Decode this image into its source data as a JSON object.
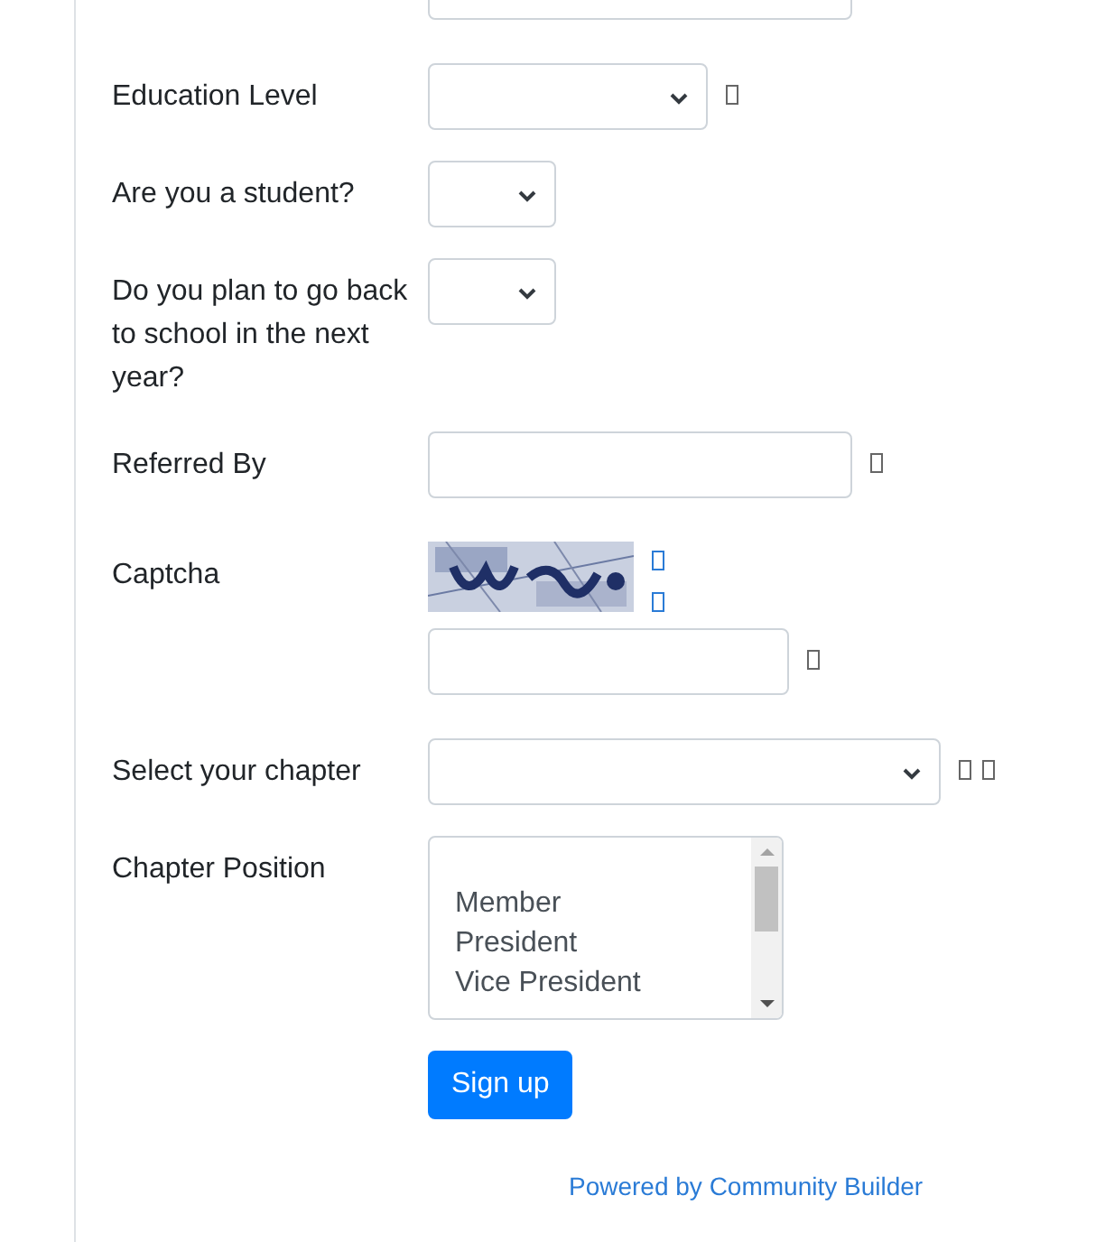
{
  "form": {
    "fields": [
      {
        "kind": "text"
      },
      {
        "kind": "select",
        "label": "Education Level",
        "hint_icons": [
          {
            "kind": "box"
          }
        ]
      },
      {
        "kind": "select",
        "label": "Are you a student?"
      },
      {
        "kind": "select",
        "label": "Do you plan to go back to school in the next year?"
      },
      {
        "kind": "text",
        "label": "Referred By",
        "hint_icons": [
          {
            "kind": "box"
          }
        ]
      },
      {
        "kind": "captcha",
        "label": "Captcha",
        "image": {
          "kind": "picture"
        },
        "image_icons": [
          {
            "kind": "box"
          },
          {
            "kind": "box"
          }
        ],
        "hint_icons": [
          {
            "kind": "box"
          }
        ]
      },
      {
        "kind": "select",
        "label": "Select your chapter",
        "hint_icons": [
          {
            "kind": "box"
          },
          {
            "kind": "box"
          }
        ]
      },
      {
        "kind": "listbox",
        "label": "Chapter Position",
        "options": [
          "Member",
          "President",
          "Vice President"
        ]
      }
    ],
    "submit": "Sign up",
    "footer_link": "Powered by Community Builder"
  }
}
